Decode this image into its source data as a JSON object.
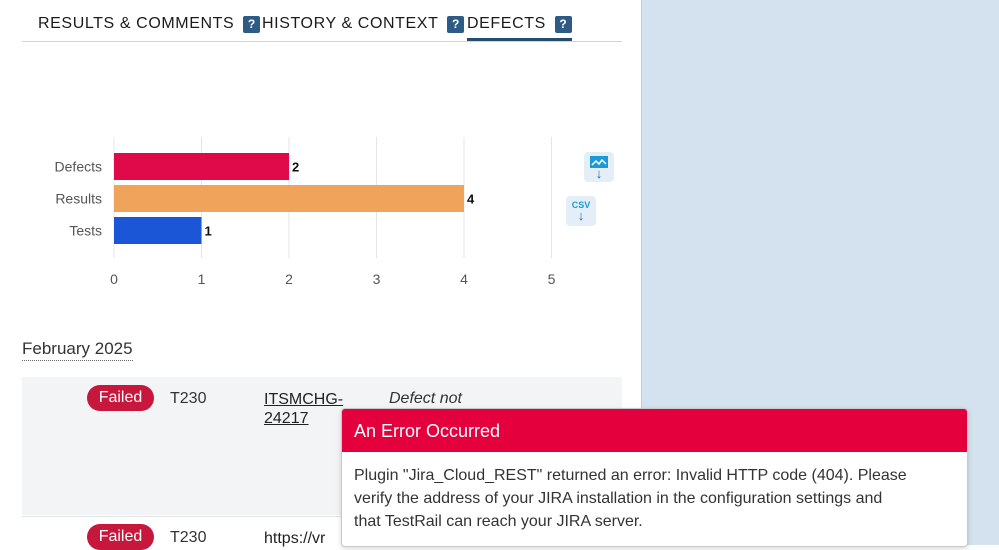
{
  "tabs": [
    {
      "label": "RESULTS & COMMENTS",
      "help": "?"
    },
    {
      "label": "HISTORY & CONTEXT",
      "help": "?"
    },
    {
      "label": "DEFECTS",
      "help": "?",
      "active": true
    }
  ],
  "chart_data": {
    "type": "bar",
    "orientation": "horizontal",
    "categories": [
      "Defects",
      "Results",
      "Tests"
    ],
    "values": [
      2,
      4,
      1
    ],
    "colors": [
      "#e0094a",
      "#f0a35a",
      "#1a56d6"
    ],
    "xlim": [
      0,
      5
    ],
    "xticks": [
      "0",
      "1",
      "2",
      "3",
      "4",
      "5"
    ],
    "grid": true,
    "title": "",
    "xlabel": "",
    "ylabel": ""
  },
  "downloads": {
    "image_icon": "chart-image-icon",
    "csv_label": "CSV"
  },
  "month": "February 2025",
  "rows": [
    {
      "status": "Failed",
      "test_id": "T230",
      "defect": "ITSMCHG-\n24217",
      "defect_status": "Defect not"
    },
    {
      "status": "Failed",
      "test_id": "T230",
      "defect": "https://vr",
      "defect_status": ""
    }
  ],
  "error": {
    "title": "An Error Occurred",
    "line1": "Plugin \"Jira_Cloud_REST\" returned an error: Invalid HTTP code (404). Please",
    "line2": "verify the address of your JIRA installation in the configuration settings and",
    "line3": "that TestRail can reach your JIRA server."
  },
  "colors": {
    "accent": "#2d5b86",
    "failed": "#c8173c",
    "error": "#e3003d",
    "sidebar_bg": "#d3e2ee"
  }
}
